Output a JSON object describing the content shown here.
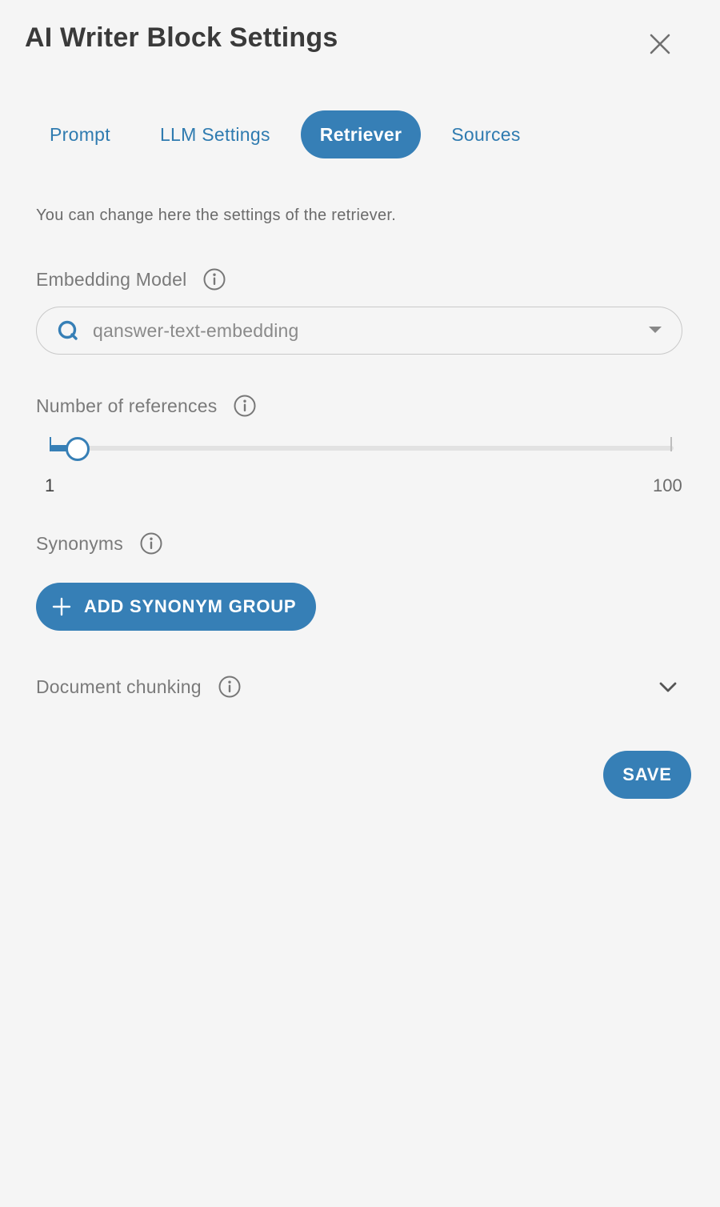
{
  "dialog": {
    "title": "AI Writer Block Settings",
    "close_icon": "close-icon"
  },
  "tabs": [
    {
      "label": "Prompt",
      "active": false
    },
    {
      "label": "LLM Settings",
      "active": false
    },
    {
      "label": "Retriever",
      "active": true
    },
    {
      "label": "Sources",
      "active": false
    }
  ],
  "retriever": {
    "description": "You can change here the settings of the retriever.",
    "embedding_model": {
      "label": "Embedding Model",
      "value": "qanswer-text-embedding",
      "icon": "qanswer-logo-icon"
    },
    "references": {
      "label": "Number of references",
      "min_label": "1",
      "max_label": "100",
      "min": 1,
      "max": 100,
      "value": 5
    },
    "synonyms": {
      "label": "Synonyms",
      "add_button_label": "ADD SYNONYM GROUP"
    },
    "chunking": {
      "label": "Document chunking",
      "expanded": false
    },
    "save_label": "SAVE"
  },
  "colors": {
    "accent": "#367fb6",
    "tab_text": "#2f7bb0",
    "background": "#f5f5f5",
    "label_text": "#7a7a7a"
  }
}
